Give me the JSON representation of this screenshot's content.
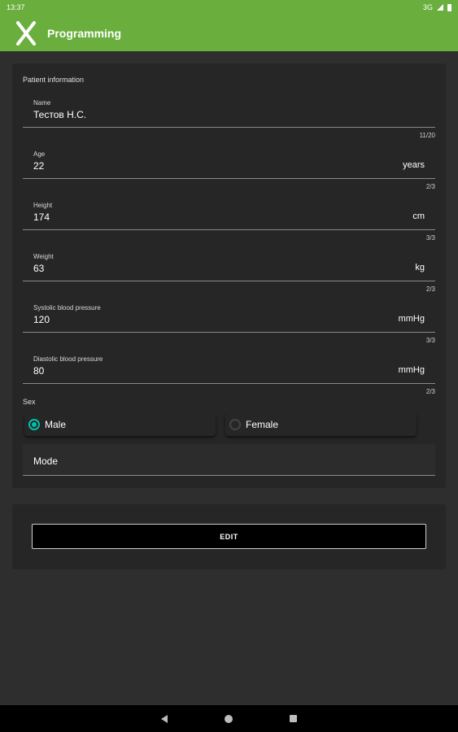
{
  "status_bar": {
    "time": "13:37",
    "network": "3G"
  },
  "app_bar": {
    "title": "Programming"
  },
  "patient": {
    "section_title": "Patient information",
    "fields": [
      {
        "label": "Name",
        "value": "Тестов Н.С.",
        "suffix": "",
        "counter": "11/20"
      },
      {
        "label": "Age",
        "value": "22",
        "suffix": "years",
        "counter": "2/3"
      },
      {
        "label": "Height",
        "value": "174",
        "suffix": "cm",
        "counter": "3/3"
      },
      {
        "label": "Weight",
        "value": "63",
        "suffix": "kg",
        "counter": "2/3"
      },
      {
        "label": "Systolic blood pressure",
        "value": "120",
        "suffix": "mmHg",
        "counter": "3/3"
      },
      {
        "label": "Diastolic blood pressure",
        "value": "80",
        "suffix": "mmHg",
        "counter": "2/3"
      }
    ],
    "sex_label": "Sex",
    "sex_options": [
      {
        "label": "Male",
        "selected": true
      },
      {
        "label": "Female",
        "selected": false
      }
    ],
    "mode_label": "Mode"
  },
  "actions": {
    "edit_label": "EDIT"
  },
  "colors": {
    "accent": "#6aaf3d",
    "radio": "#00c2a8",
    "background": "#2e2e2e",
    "card": "#262626"
  }
}
